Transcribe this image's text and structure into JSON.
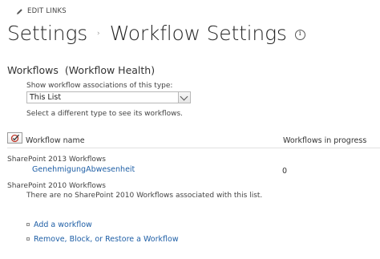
{
  "edit_links": {
    "label": "EDIT LINKS",
    "icon": "pencil-icon"
  },
  "breadcrumb": {
    "parent": "Settings",
    "separator": "›",
    "current": "Workflow Settings",
    "info_icon": "info-icon"
  },
  "section": {
    "title": "Workflows",
    "subtitle": "(Workflow Health)"
  },
  "association_select": {
    "label": "Show workflow associations of this type:",
    "value": "This List",
    "help_text": "Select a different type to see its workflows."
  },
  "table": {
    "columns": [
      "Workflow name",
      "Workflows in progress"
    ],
    "groups": [
      {
        "heading": "SharePoint 2013 Workflows",
        "rows": [
          {
            "name": "GenehmigungAbwesenheit",
            "in_progress": "0"
          }
        ]
      },
      {
        "heading": "SharePoint 2010 Workflows",
        "empty_message": "There are no SharePoint 2010 Workflows associated with this list."
      }
    ]
  },
  "actions": [
    {
      "label": "Add a workflow"
    },
    {
      "label": "Remove, Block, or Restore a Workflow"
    }
  ],
  "colors": {
    "link": "#1f5fa6",
    "text": "#444444",
    "title": "#262626",
    "accent_check": "#c0392b"
  }
}
